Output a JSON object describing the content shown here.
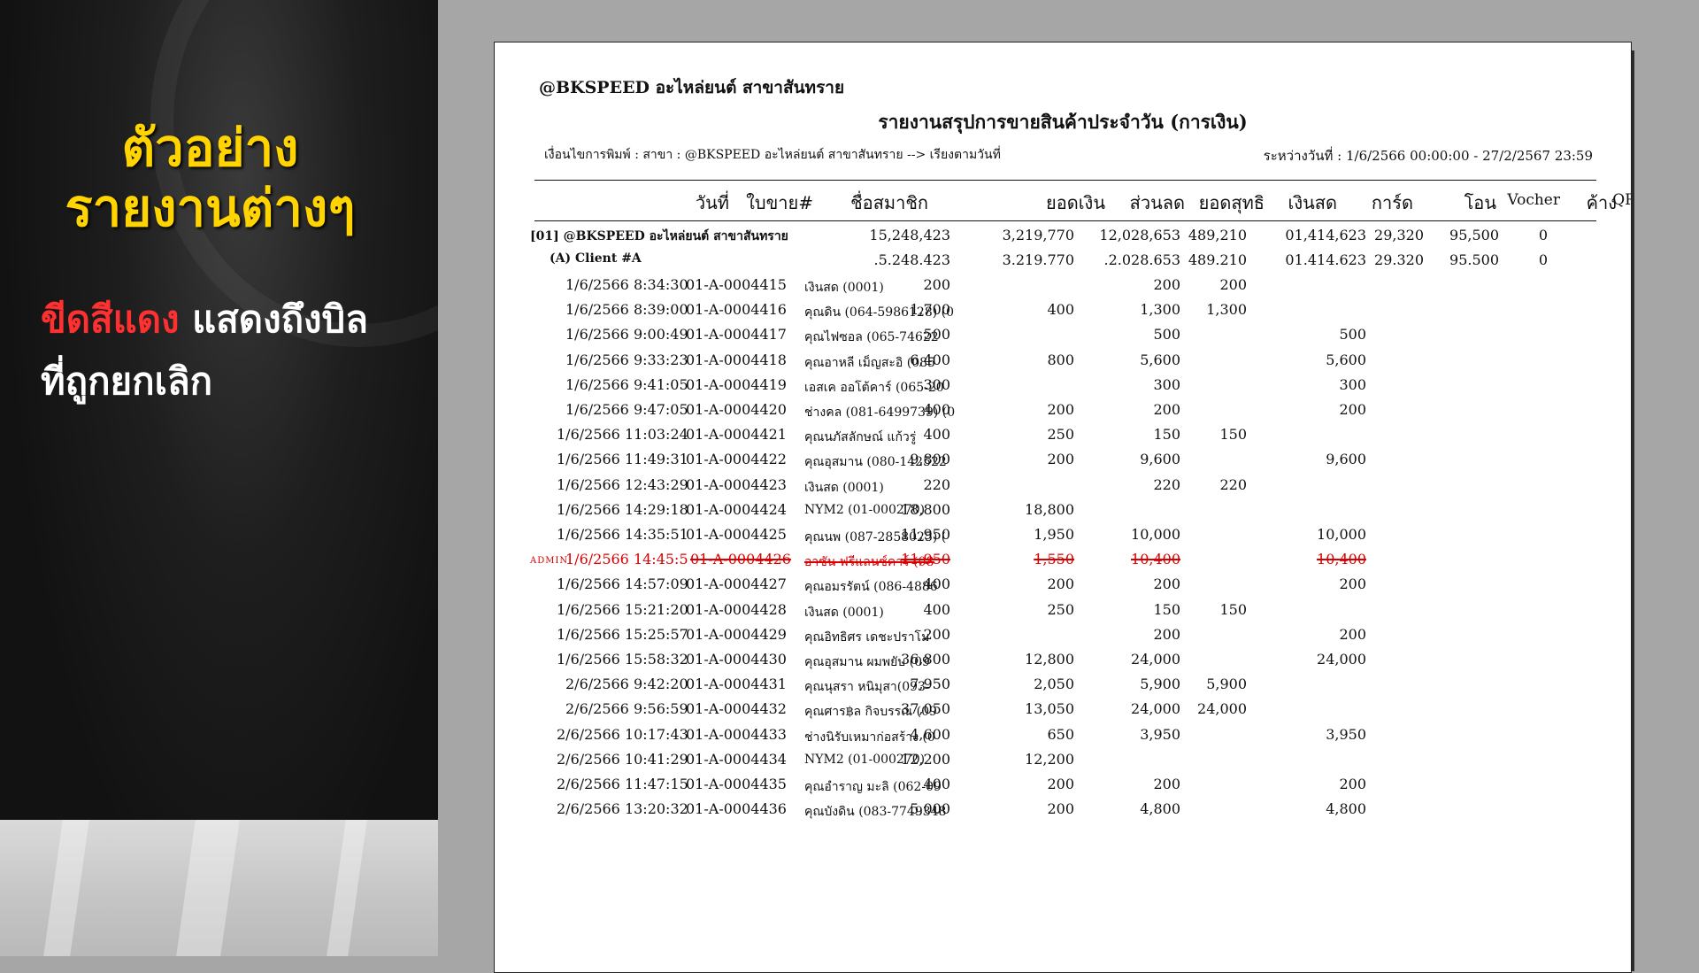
{
  "promo": {
    "headline_line1": "ตัวอย่าง",
    "headline_line2": "รายงานต่างๆ",
    "sub_red": "ขีดสีแดง",
    "sub_rest": " แสดงถึงบิล",
    "sub_line2": "ที่ถูกยกเลิก"
  },
  "report": {
    "company": "@BKSPEED อะไหล่ยนต์ สาขาสันทราย",
    "title": "รายงานสรุปการขายสินค้าประจำวัน (การเงิน)",
    "condition": "เงื่อนไขการพิมพ์ : สาขา : @BKSPEED อะไหล่ยนต์ สาขาสันทราย --> เรียงตามวันที่",
    "date_range": "ระหว่างวันที่ : 1/6/2566 00:00:00 - 27/2/2567 23:59",
    "columns": [
      "วันที่",
      "ใบขาย#",
      "ชื่อสมาชิก",
      "ยอดเงิน",
      "ส่วนลด",
      "ยอดสุทธิ",
      "เงินสด",
      "การ์ด",
      "โอน",
      "Vocher",
      "ค้าง",
      "QR"
    ],
    "branch_total": {
      "label": "[01] @BKSPEED อะไหล่ยนต์ สาขาสันทราย",
      "amount": "15,248,423",
      "discount": "3,219,770",
      "net": "12,028,653",
      "cash": "489,210",
      "transfer": "01,414,623",
      "voucher": "29,320",
      "owed": "95,500",
      "qr": "0"
    },
    "client_total": {
      "label": "(A) Client #A",
      "amount": ".5.248.423",
      "discount": "3.219.770",
      "net": ".2.028.653",
      "cash": "489.210",
      "transfer": "01.414.623",
      "voucher": "29.320",
      "owed": "95.500",
      "qr": "0"
    },
    "rows": [
      {
        "date": "1/6/2566 8:34:30",
        "bill": "01-A-0004415",
        "member": "เงินสด (0001)",
        "amount": "200",
        "discount": "",
        "net": "200",
        "cash": "200",
        "transfer": "",
        "cancelled": false
      },
      {
        "date": "1/6/2566 8:39:00",
        "bill": "01-A-0004416",
        "member": "คุณดิน (064-5986128) (0",
        "amount": "1,700",
        "discount": "400",
        "net": "1,300",
        "cash": "1,300",
        "transfer": "",
        "cancelled": false
      },
      {
        "date": "1/6/2566 9:00:49",
        "bill": "01-A-0004417",
        "member": "คุณไฟซอล (065-74622",
        "amount": "500",
        "discount": "",
        "net": "500",
        "cash": "",
        "transfer": "500",
        "cancelled": false
      },
      {
        "date": "1/6/2566 9:33:23",
        "bill": "01-A-0004418",
        "member": "คุณอาหลี เม็ญสะอิ (085",
        "amount": "6,400",
        "discount": "800",
        "net": "5,600",
        "cash": "",
        "transfer": "5,600",
        "cancelled": false
      },
      {
        "date": "1/6/2566 9:41:05",
        "bill": "01-A-0004419",
        "member": "เอสเค ออโต้คาร์ (065-20",
        "amount": "300",
        "discount": "",
        "net": "300",
        "cash": "",
        "transfer": "300",
        "cancelled": false
      },
      {
        "date": "1/6/2566 9:47:05",
        "bill": "01-A-0004420",
        "member": "ช่างคล (081-6499739) (0",
        "amount": "400",
        "discount": "200",
        "net": "200",
        "cash": "",
        "transfer": "200",
        "cancelled": false
      },
      {
        "date": "1/6/2566 11:03:24",
        "bill": "01-A-0004421",
        "member": "คุณนภัสลักษณ์ แก้วรู่",
        "amount": "400",
        "discount": "250",
        "net": "150",
        "cash": "150",
        "transfer": "",
        "cancelled": false
      },
      {
        "date": "1/6/2566 11:49:31",
        "bill": "01-A-0004422",
        "member": "คุณอุสมาน (080-142522",
        "amount": "9,800",
        "discount": "200",
        "net": "9,600",
        "cash": "",
        "transfer": "9,600",
        "cancelled": false
      },
      {
        "date": "1/6/2566 12:43:29",
        "bill": "01-A-0004423",
        "member": "เงินสด (0001)",
        "amount": "220",
        "discount": "",
        "net": "220",
        "cash": "220",
        "transfer": "",
        "cancelled": false
      },
      {
        "date": "1/6/2566 14:29:18",
        "bill": "01-A-0004424",
        "member": "NYM2 (01-000270)",
        "amount": "18,800",
        "discount": "18,800",
        "net": "",
        "cash": "",
        "transfer": "",
        "cancelled": false
      },
      {
        "date": "1/6/2566 14:35:51",
        "bill": "01-A-0004425",
        "member": "คุณนพ (087-2858025) (",
        "amount": "11,950",
        "discount": "1,950",
        "net": "10,000",
        "cash": "",
        "transfer": "10,000",
        "cancelled": false
      },
      {
        "date": "1/6/2566 14:45:5",
        "bill": "01-A-0004426",
        "member": "อาซัน ฟรีแลนซ์คาร์ (08",
        "amount": "11,950",
        "discount": "1,550",
        "net": "10,400",
        "cash": "",
        "transfer": "10,400",
        "cancelled": true,
        "flag": "ADMIN"
      },
      {
        "date": "1/6/2566 14:57:09",
        "bill": "01-A-0004427",
        "member": "คุณอมรรัตน์ (086-4886",
        "amount": "400",
        "discount": "200",
        "net": "200",
        "cash": "",
        "transfer": "200",
        "cancelled": false
      },
      {
        "date": "1/6/2566 15:21:20",
        "bill": "01-A-0004428",
        "member": "เงินสด (0001)",
        "amount": "400",
        "discount": "250",
        "net": "150",
        "cash": "150",
        "transfer": "",
        "cancelled": false
      },
      {
        "date": "1/6/2566 15:25:57",
        "bill": "01-A-0004429",
        "member": "คุณอิทธิศร เดชะปราโม",
        "amount": "200",
        "discount": "",
        "net": "200",
        "cash": "",
        "transfer": "200",
        "cancelled": false
      },
      {
        "date": "1/6/2566 15:58:32",
        "bill": "01-A-0004430",
        "member": "คุณอุสมาน ผมพยับ (09",
        "amount": "36,800",
        "discount": "12,800",
        "net": "24,000",
        "cash": "",
        "transfer": "24,000",
        "cancelled": false
      },
      {
        "date": "2/6/2566 9:42:20",
        "bill": "01-A-0004431",
        "member": "คุณนุสรา หนิมุสา(093-",
        "amount": "7,950",
        "discount": "2,050",
        "net": "5,900",
        "cash": "5,900",
        "transfer": "",
        "cancelled": false
      },
      {
        "date": "2/6/2566 9:56:59",
        "bill": "01-A-0004432",
        "member": "คุณศาร฿ล กิจบรรณ (09",
        "amount": "37,050",
        "discount": "13,050",
        "net": "24,000",
        "cash": "24,000",
        "transfer": "",
        "cancelled": false
      },
      {
        "date": "2/6/2566 10:17:43",
        "bill": "01-A-0004433",
        "member": "ช่างนิรับเหมาก่อสร้าง (0",
        "amount": "4,600",
        "discount": "650",
        "net": "3,950",
        "cash": "",
        "transfer": "3,950",
        "cancelled": false
      },
      {
        "date": "2/6/2566 10:41:29",
        "bill": "01-A-0004434",
        "member": "NYM2 (01-000270)",
        "amount": "12,200",
        "discount": "12,200",
        "net": "",
        "cash": "",
        "transfer": "",
        "cancelled": false
      },
      {
        "date": "2/6/2566 11:47:15",
        "bill": "01-A-0004435",
        "member": "คุณอำราญ มะลิ (062-09",
        "amount": "400",
        "discount": "200",
        "net": "200",
        "cash": "",
        "transfer": "200",
        "cancelled": false
      },
      {
        "date": "2/6/2566 13:20:32",
        "bill": "01-A-0004436",
        "member": "คุณบังดิน (083-7749348",
        "amount": "5,000",
        "discount": "200",
        "net": "4,800",
        "cash": "",
        "transfer": "4,800",
        "cancelled": false
      }
    ]
  }
}
